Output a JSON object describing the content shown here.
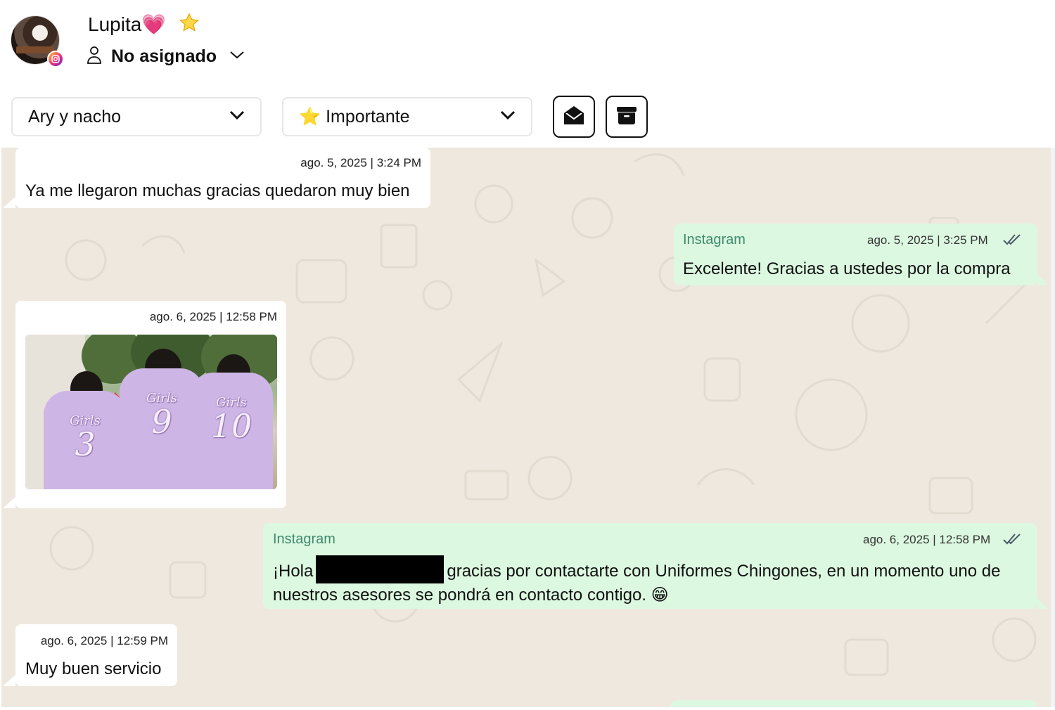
{
  "header": {
    "contact_name": "Lupita💗",
    "assignee": "No asignado",
    "team_select": "Ary y nacho",
    "label_select": "⭐ Importante"
  },
  "messages": [
    {
      "id": "m1",
      "direction": "incoming",
      "timestamp": "ago. 5, 2025 | 3:24 PM",
      "text": "Ya me llegaron muchas gracias quedaron muy bien"
    },
    {
      "id": "m2",
      "direction": "outgoing",
      "channel": "Instagram",
      "timestamp": "ago. 5, 2025 | 3:25 PM",
      "text": "Excelente! Gracias a ustedes por la compra",
      "status": "read"
    },
    {
      "id": "m3",
      "direction": "incoming",
      "timestamp": "ago. 6, 2025 | 12:58 PM",
      "image": "photo of three girls in lilac jerseys",
      "jersey_texts": {
        "script": "Girls",
        "numbers": [
          "3",
          "9",
          "10"
        ]
      }
    },
    {
      "id": "m4",
      "direction": "outgoing",
      "channel": "Instagram",
      "timestamp": "ago. 6, 2025 | 12:58 PM",
      "text_before": "¡Hola",
      "text_after": "gracias por contactarte con Uniformes Chingones, en un momento uno de nuestros asesores se pondrá en contacto contigo. 😁",
      "status": "read"
    },
    {
      "id": "m5",
      "direction": "incoming",
      "timestamp": "ago. 6, 2025 | 12:59 PM",
      "text": "Muy buen servicio"
    }
  ],
  "colors": {
    "chat_bg": "#efe8df",
    "incoming_bubble": "#ffffff",
    "outgoing_bubble": "#dcf8e0",
    "channel_label": "#3f8a6e",
    "read_ticks": "#4a5a6a"
  },
  "icons": [
    "instagram-icon",
    "star-icon",
    "user-icon",
    "chevron-down-icon",
    "mark-unread-icon",
    "archive-icon",
    "double-check-icon"
  ]
}
